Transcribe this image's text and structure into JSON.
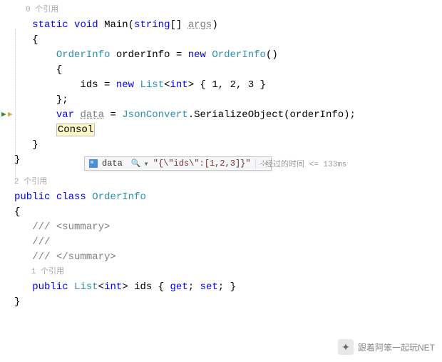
{
  "refs": {
    "main": "0 个引用",
    "class": "2 个引用",
    "ids": "1 个引用"
  },
  "code": {
    "main_sig_1": "static",
    "main_sig_2": "void",
    "main_sig_3": "Main",
    "main_sig_4": "string",
    "main_sig_5": "args",
    "oi_type": "OrderInfo",
    "oi_var": "orderInfo",
    "oi_new": "new",
    "ids_field": "ids",
    "list_type": "List",
    "int_type": "int",
    "list_init": "{ 1, 2, 3 }",
    "var_kw": "var",
    "data_var": "data",
    "json_type": "JsonConvert",
    "serialize": "SerializeObject",
    "console": "Consol",
    "public_kw": "public",
    "class_kw": "class",
    "summary_open": "/// <summary>",
    "summary_mid": "/// ",
    "summary_close": "/// </summary>",
    "get": "get",
    "set": "set"
  },
  "datatip": {
    "name": "data",
    "value": "\"{\\\"ids\\\":[1,2,3]}\""
  },
  "perftip": "经过的时间 <= 133ms",
  "watermark": "跟着阿笨一起玩NET"
}
